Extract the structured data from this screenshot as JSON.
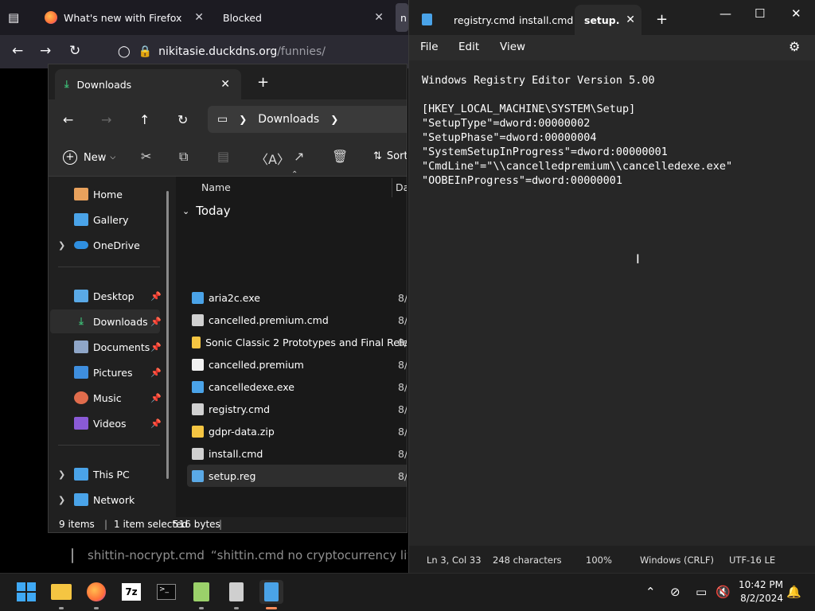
{
  "firefox": {
    "tabs": [
      {
        "label": "What's new with Firefox"
      },
      {
        "label": "Blocked"
      },
      {
        "label": "n"
      }
    ],
    "url": {
      "host": "nikitasie.duckdns.org",
      "path": "/funnies/"
    }
  },
  "explorer": {
    "tab_title": "Downloads",
    "breadcrumb": "Downloads",
    "toolbar": {
      "new_label": "New",
      "sort_label": "Sort"
    },
    "sidebar": [
      {
        "label": "Home",
        "color": "#e8a15c"
      },
      {
        "label": "Gallery",
        "color": "#4aa3e8"
      },
      {
        "label": "OneDrive",
        "color": "#2f8fe0"
      },
      {
        "label": "Desktop",
        "color": "#5aa9e6"
      },
      {
        "label": "Downloads",
        "color": "#3cb371"
      },
      {
        "label": "Documents",
        "color": "#8fa6c8"
      },
      {
        "label": "Pictures",
        "color": "#3e8ede"
      },
      {
        "label": "Music",
        "color": "#e06c4c"
      },
      {
        "label": "Videos",
        "color": "#8a5ad6"
      },
      {
        "label": "This PC",
        "color": "#4aa3e8"
      },
      {
        "label": "Network",
        "color": "#4aa3e8"
      }
    ],
    "columns": {
      "name": "Name",
      "date": "Da"
    },
    "group": "Today",
    "files": [
      {
        "name": "aria2c.exe",
        "date": "8/",
        "icon": "exe-icon"
      },
      {
        "name": "cancelled.premium.cmd",
        "date": "8/",
        "icon": "cmd-file-icon"
      },
      {
        "name": "Sonic Classic 2 Prototypes and Final Rele...",
        "date": "8/",
        "icon": "folder-icon"
      },
      {
        "name": "cancelled.premium",
        "date": "8/",
        "icon": "blank-file-icon"
      },
      {
        "name": "cancelledexe.exe",
        "date": "8/",
        "icon": "exe-icon"
      },
      {
        "name": "registry.cmd",
        "date": "8/",
        "icon": "cmd-file-icon"
      },
      {
        "name": "gdpr-data.zip",
        "date": "8/",
        "icon": "zip-folder-icon"
      },
      {
        "name": "install.cmd",
        "date": "8/",
        "icon": "cmd-file-icon"
      },
      {
        "name": "setup.reg",
        "date": "8/",
        "icon": "reg-file-icon"
      }
    ],
    "status": {
      "items": "9 items",
      "selected": "1 item selected",
      "size": "516 bytes"
    }
  },
  "notepad": {
    "tabs": [
      "registry.cmd",
      "install.cmd",
      "setup."
    ],
    "menu": [
      "File",
      "Edit",
      "View"
    ],
    "content": "Windows Registry Editor Version 5.00\n\n[HKEY_LOCAL_MACHINE\\SYSTEM\\Setup]\n\"SetupType\"=dword:00000002\n\"SetupPhase\"=dword:00000004\n\"SystemSetupInProgress\"=dword:00000001\n\"CmdLine\"=\"\\\\cancelledpremium\\\\cancelledexe.exe\"\n\"OOBEInProgress\"=dword:00000001",
    "status": {
      "position": "Ln 3, Col 33",
      "chars": "248 characters",
      "zoom": "100%",
      "line_ending": "Windows (CRLF)",
      "encoding": "UTF-16 LE"
    }
  },
  "hint": {
    "file": "shittin-nocrypt.cmd",
    "desc": "“shittin.cmd no cryptocurrency lite"
  },
  "clock": {
    "time": "10:42 PM",
    "date": "8/2/2024"
  }
}
